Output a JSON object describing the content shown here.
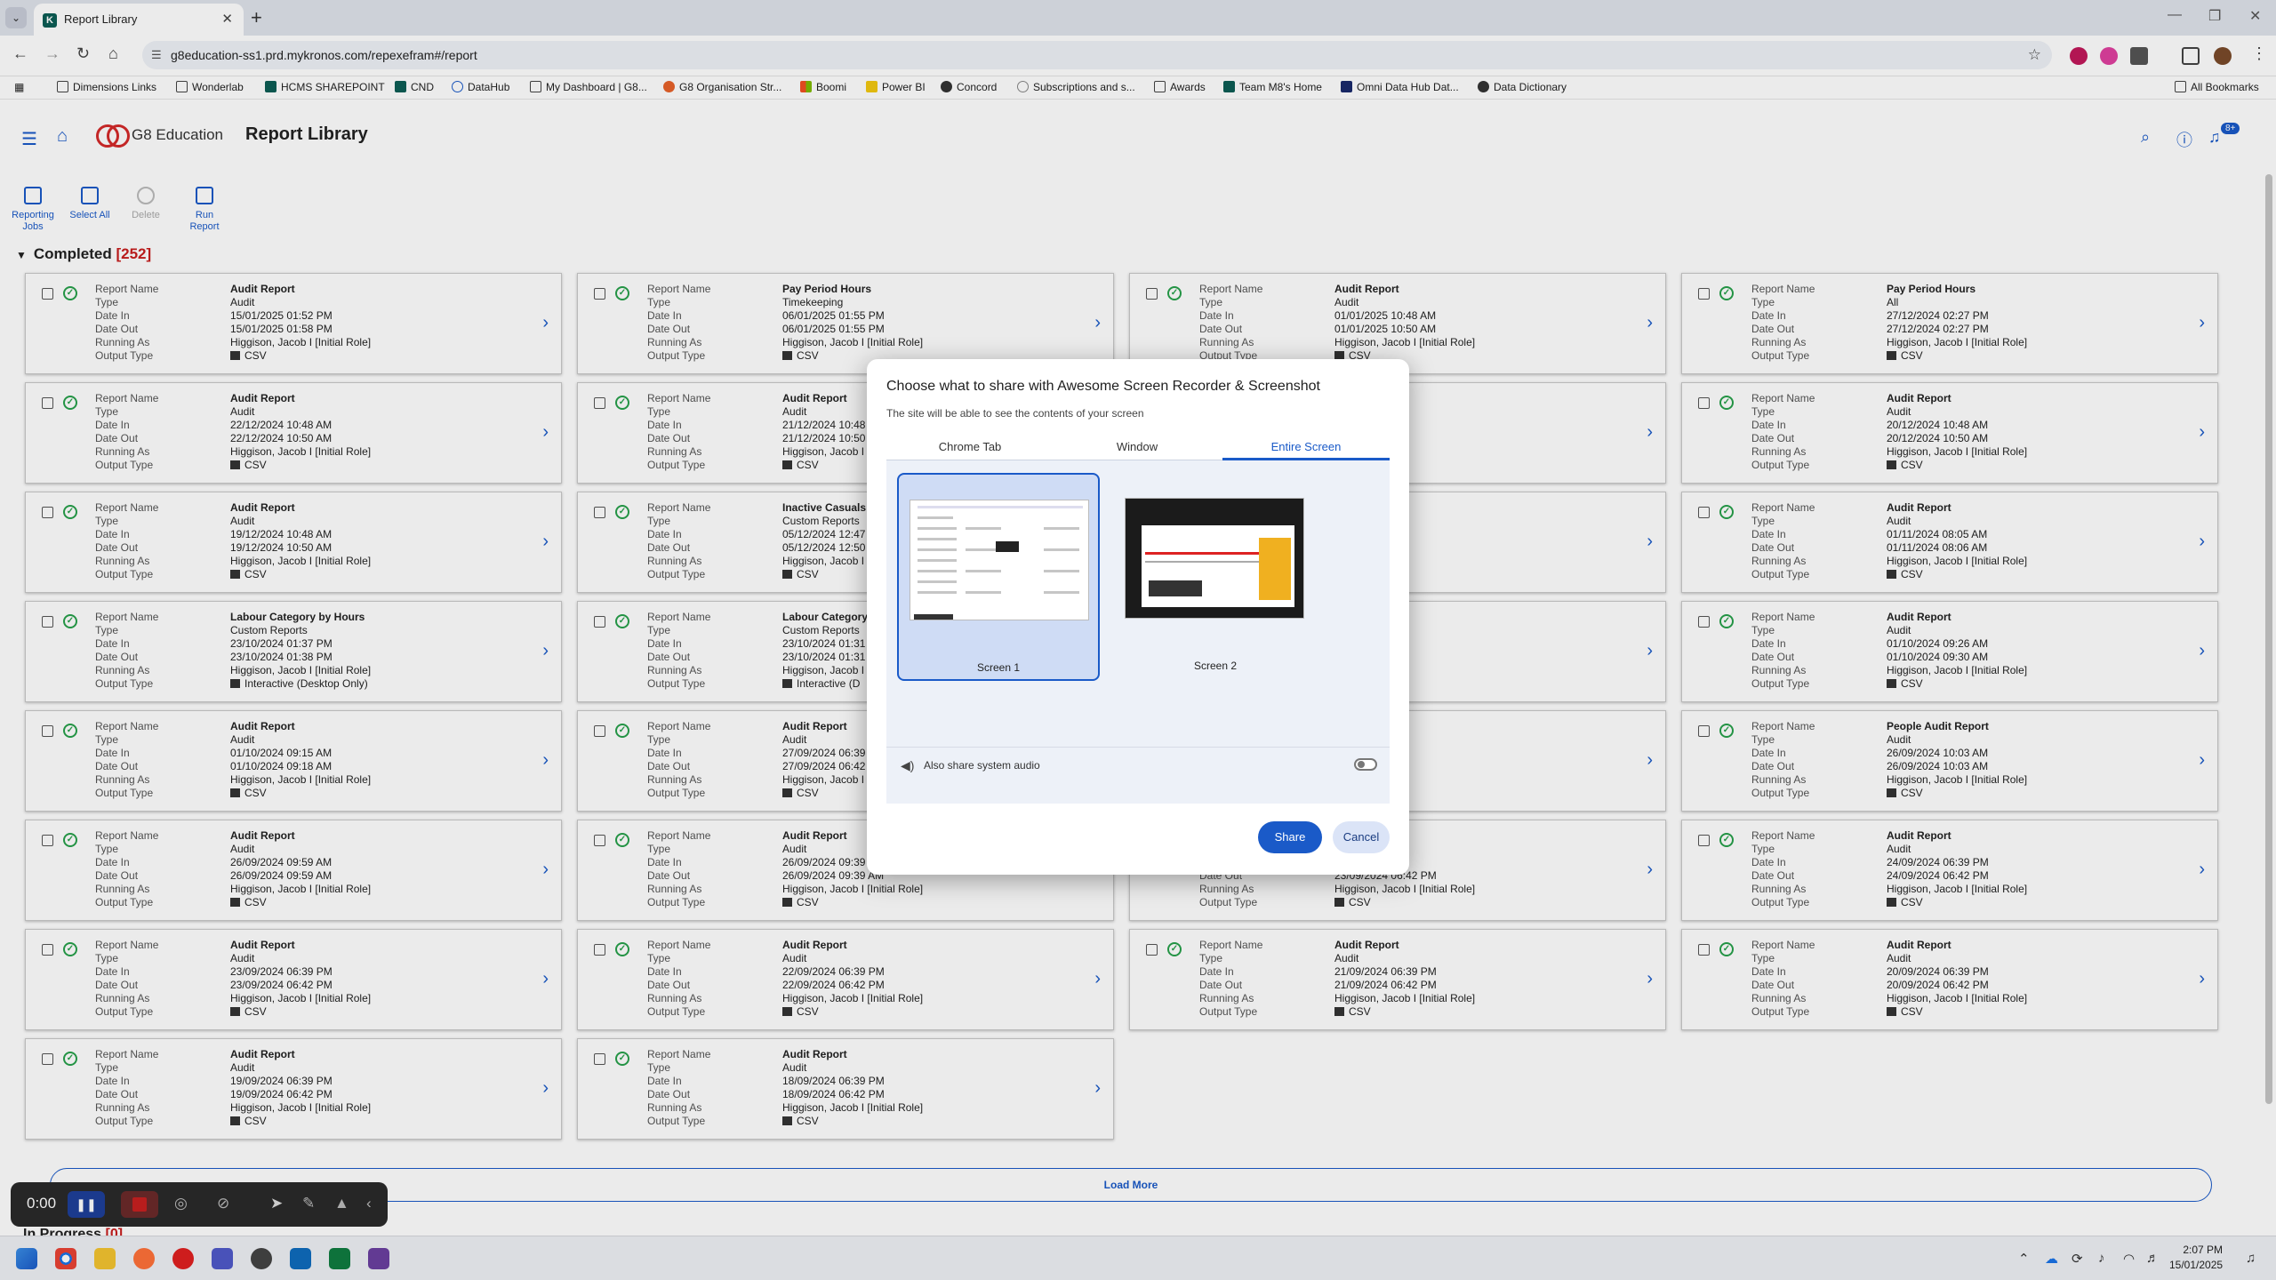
{
  "browser": {
    "tab_title": "Report Library",
    "url": "g8education-ss1.prd.mykronos.com/repexefram#/report",
    "bookmarks": [
      "Dimensions Links",
      "Wonderlab",
      "HCMS SHAREPOINT",
      "CND",
      "DataHub",
      "My Dashboard | G8...",
      "G8 Organisation Str...",
      "Boomi",
      "Power BI",
      "Concord",
      "Subscriptions and s...",
      "Awards",
      "Team M8's Home",
      "Omni Data Hub Dat...",
      "Data Dictionary"
    ],
    "all_bookmarks": "All Bookmarks",
    "colors": {
      "accent": "#1a5ac8",
      "success": "#27a04a",
      "alert": "#c81e1e"
    }
  },
  "app": {
    "logo_text": "G8 Education",
    "page_title": "Report Library",
    "notification_count": "8+"
  },
  "toolbar": {
    "reporting_jobs": "Reporting Jobs",
    "select_all": "Select All",
    "delete": "Delete",
    "run_report": "Run Report"
  },
  "section": {
    "title": "Completed",
    "count": "[252]"
  },
  "labels": [
    "Report Name",
    "Type",
    "Date In",
    "Date Out",
    "Running As",
    "Output Type"
  ],
  "cards": [
    {
      "name": "Audit Report",
      "type": "Audit",
      "date_in": "15/01/2025 01:52 PM",
      "date_out": "15/01/2025 01:58 PM",
      "running_as": "Higgison, Jacob I [Initial Role]",
      "output": "CSV"
    },
    {
      "name": "Pay Period Hours",
      "type": "Timekeeping",
      "date_in": "06/01/2025 01:55 PM",
      "date_out": "06/01/2025 01:55 PM",
      "running_as": "Higgison, Jacob I [Initial Role]",
      "output": "CSV"
    },
    {
      "name": "Audit Report",
      "type": "Audit",
      "date_in": "01/01/2025 10:48 AM",
      "date_out": "01/01/2025 10:50 AM",
      "running_as": "Higgison, Jacob I [Initial Role]",
      "output": "CSV"
    },
    {
      "name": "Pay Period Hours",
      "type": "All",
      "date_in": "27/12/2024 02:27 PM",
      "date_out": "27/12/2024 02:27 PM",
      "running_as": "Higgison, Jacob I [Initial Role]",
      "output": "CSV"
    },
    {
      "name": "Audit Report",
      "type": "Audit",
      "date_in": "22/12/2024 10:48 AM",
      "date_out": "22/12/2024 10:50 AM",
      "running_as": "Higgison, Jacob I [Initial Role]",
      "output": "CSV"
    },
    {
      "name": "Audit Report",
      "type": "Audit",
      "date_in": "21/12/2024 10:48",
      "date_out": "21/12/2024 10:50",
      "running_as": "Higgison, Jacob I",
      "output": "CSV"
    },
    {
      "name": "hours",
      "type": "",
      "date_in": "26 PM",
      "date_out": "27 PM",
      "running_as": "I [Initial Role]",
      "output": ""
    },
    {
      "name": "Audit Report",
      "type": "Audit",
      "date_in": "20/12/2024 10:48 AM",
      "date_out": "20/12/2024 10:50 AM",
      "running_as": "Higgison, Jacob I [Initial Role]",
      "output": "CSV"
    },
    {
      "name": "Audit Report",
      "type": "Audit",
      "date_in": "19/12/2024 10:48 AM",
      "date_out": "19/12/2024 10:50 AM",
      "running_as": "Higgison, Jacob I [Initial Role]",
      "output": "CSV"
    },
    {
      "name": "Inactive Casuals",
      "type": "Custom Reports",
      "date_in": "05/12/2024 12:47",
      "date_out": "05/12/2024 12:50",
      "running_as": "Higgison, Jacob I",
      "output": "CSV"
    },
    {
      "name": "",
      "type": "",
      "date_in": "05",
      "date_out": "06",
      "running_as": "I [Initial Role]",
      "output": ""
    },
    {
      "name": "Audit Report",
      "type": "Audit",
      "date_in": "01/11/2024 08:05 AM",
      "date_out": "01/11/2024 08:06 AM",
      "running_as": "Higgison, Jacob I [Initial Role]",
      "output": "CSV"
    },
    {
      "name": "Labour Category by Hours",
      "type": "Custom Reports",
      "date_in": "23/10/2024 01:37 PM",
      "date_out": "23/10/2024 01:38 PM",
      "running_as": "Higgison, Jacob I [Initial Role]",
      "output": "Interactive (Desktop Only)"
    },
    {
      "name": "Labour Category",
      "type": "Custom Reports",
      "date_in": "23/10/2024 01:31",
      "date_out": "23/10/2024 01:31",
      "running_as": "Higgison, Jacob I",
      "output": "Interactive (D"
    },
    {
      "name": "ory by Hours",
      "type": "",
      "date_in": "19 PM",
      "date_out": "22 PM",
      "running_as": "I [Initial Role]",
      "output": ""
    },
    {
      "name": "Audit Report",
      "type": "Audit",
      "date_in": "01/10/2024 09:26 AM",
      "date_out": "01/10/2024 09:30 AM",
      "running_as": "Higgison, Jacob I [Initial Role]",
      "output": "CSV"
    },
    {
      "name": "Audit Report",
      "type": "Audit",
      "date_in": "01/10/2024 09:15 AM",
      "date_out": "01/10/2024 09:18 AM",
      "running_as": "Higgison, Jacob I [Initial Role]",
      "output": "CSV"
    },
    {
      "name": "Audit Report",
      "type": "Audit",
      "date_in": "27/09/2024 06:39",
      "date_out": "27/09/2024 06:42",
      "running_as": "Higgison, Jacob I",
      "output": "CSV"
    },
    {
      "name": "Audit",
      "type": "",
      "date_in": "44 PM",
      "date_out": "46 PM",
      "running_as": "I [Initial Role]",
      "output": ""
    },
    {
      "name": "People Audit Report",
      "type": "Audit",
      "date_in": "26/09/2024 10:03 AM",
      "date_out": "26/09/2024 10:03 AM",
      "running_as": "Higgison, Jacob I [Initial Role]",
      "output": "CSV"
    },
    {
      "name": "Audit Report",
      "type": "Audit",
      "date_in": "26/09/2024 09:59 AM",
      "date_out": "26/09/2024 09:59 AM",
      "running_as": "Higgison, Jacob I [Initial Role]",
      "output": "CSV"
    },
    {
      "name": "Audit Report",
      "type": "Audit",
      "date_in": "26/09/2024 09:39",
      "date_out": "26/09/2024 09:39 AM",
      "running_as": "Higgison, Jacob I [Initial Role]",
      "output": "CSV"
    },
    {
      "name": "",
      "type": "",
      "date_in": "39 PM",
      "date_out": "23/09/2024 06:42 PM",
      "running_as": "Higgison, Jacob I [Initial Role]",
      "output": "CSV"
    },
    {
      "name": "Audit Report",
      "type": "Audit",
      "date_in": "24/09/2024 06:39 PM",
      "date_out": "24/09/2024 06:42 PM",
      "running_as": "Higgison, Jacob I [Initial Role]",
      "output": "CSV"
    },
    {
      "name": "Audit Report",
      "type": "Audit",
      "date_in": "23/09/2024 06:39 PM",
      "date_out": "23/09/2024 06:42 PM",
      "running_as": "Higgison, Jacob I [Initial Role]",
      "output": "CSV"
    },
    {
      "name": "Audit Report",
      "type": "Audit",
      "date_in": "22/09/2024 06:39 PM",
      "date_out": "22/09/2024 06:42 PM",
      "running_as": "Higgison, Jacob I [Initial Role]",
      "output": "CSV"
    },
    {
      "name": "Audit Report",
      "type": "Audit",
      "date_in": "21/09/2024 06:39 PM",
      "date_out": "21/09/2024 06:42 PM",
      "running_as": "Higgison, Jacob I [Initial Role]",
      "output": "CSV"
    },
    {
      "name": "Audit Report",
      "type": "Audit",
      "date_in": "20/09/2024 06:39 PM",
      "date_out": "20/09/2024 06:42 PM",
      "running_as": "Higgison, Jacob I [Initial Role]",
      "output": "CSV"
    },
    {
      "name": "Audit Report",
      "type": "Audit",
      "date_in": "19/09/2024 06:39 PM",
      "date_out": "19/09/2024 06:42 PM",
      "running_as": "Higgison, Jacob I [Initial Role]",
      "output": "CSV"
    },
    {
      "name": "Audit Report",
      "type": "Audit",
      "date_in": "18/09/2024 06:39 PM",
      "date_out": "18/09/2024 06:42 PM",
      "running_as": "Higgison, Jacob I [Initial Role]",
      "output": "CSV"
    }
  ],
  "load_more": "Load More",
  "in_progress": {
    "title": "In Progress",
    "count": "[0]"
  },
  "recorder": {
    "time": "0:00"
  },
  "clock": {
    "time": "2:07 PM",
    "date": "15/01/2025"
  },
  "share_dialog": {
    "title": "Choose what to share with Awesome Screen Recorder & Screenshot",
    "subtitle": "The site will be able to see the contents of your screen",
    "tabs": [
      "Chrome Tab",
      "Window",
      "Entire Screen"
    ],
    "screen1": "Screen 1",
    "screen2": "Screen 2",
    "audio_label": "Also share system audio",
    "share": "Share",
    "cancel": "Cancel"
  }
}
